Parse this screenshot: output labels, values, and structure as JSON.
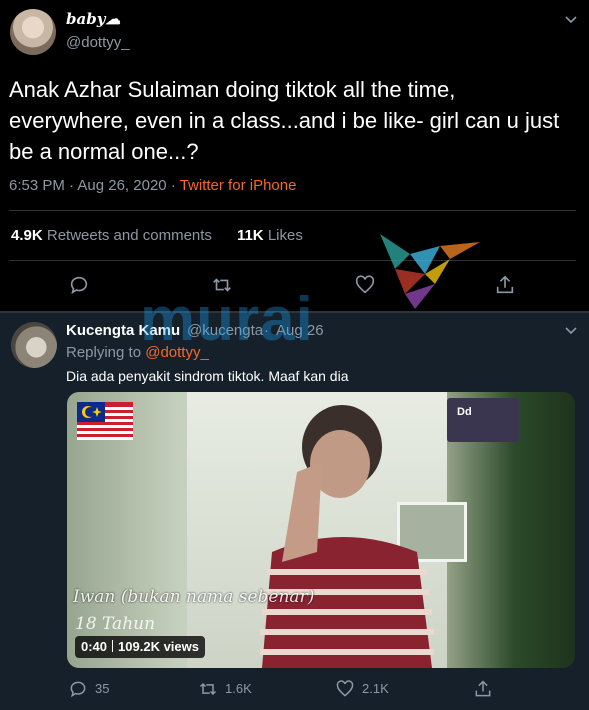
{
  "tweet": {
    "display_name": "baby☁",
    "handle": "@dottyy_",
    "text": "Anak Azhar Sulaiman doing tiktok all the time, everywhere, even in a class...and i be like- girl can u just be a normal one...?",
    "time": "6:53 PM",
    "date": "Aug 26, 2020",
    "separator": "·",
    "source": "Twitter for iPhone",
    "retweets_count": "4.9K",
    "retweets_label": "Retweets and comments",
    "likes_count": "11K",
    "likes_label": "Likes",
    "actions": [
      "reply-icon",
      "retweet-icon",
      "like-icon",
      "share-icon"
    ]
  },
  "reply": {
    "display_name": "Kucengta Kamu",
    "handle": "@kucengta",
    "separator": "·",
    "time": "Aug 26",
    "replying_prefix": "Replying to",
    "replying_to": "@dottyy_",
    "text": "Dia ada penyakit sindrom tiktok. Maaf kan dia",
    "video": {
      "duration": "0:40",
      "views": "109.2K views",
      "overlay_line1": "Iwan (bukan nama sebenar)",
      "overlay_line2": "18 Tahun",
      "corner_label": "Dd"
    },
    "reply_count": "35",
    "retweet_count": "1.6K",
    "like_count": "2.1K"
  },
  "watermark": {
    "text": "murai"
  },
  "colors": {
    "background": "#000000",
    "reply_background": "#15202b",
    "accent": "#f3682e",
    "muted": "#8b98a5",
    "watermark": "#1da1f2"
  }
}
